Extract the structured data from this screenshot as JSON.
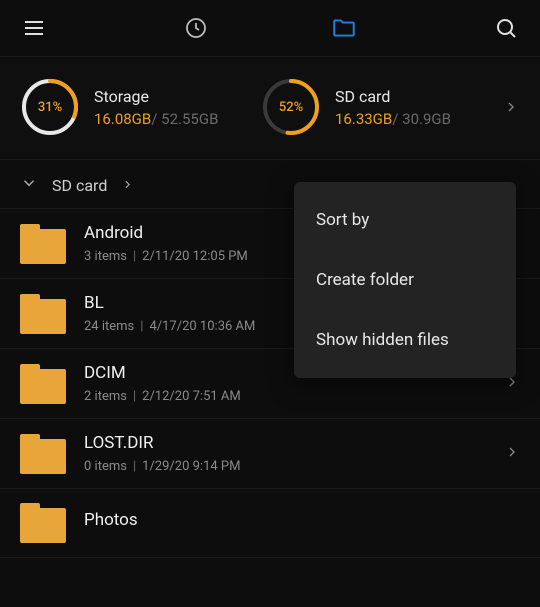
{
  "nav": {
    "menu_icon": "menu",
    "recent_icon": "clock",
    "folder_icon": "folder",
    "search_icon": "search"
  },
  "storage": {
    "internal": {
      "percent_label": "31%",
      "percent_value": 31,
      "title": "Storage",
      "used": "16.08GB",
      "sep": "/ ",
      "total": "52.55GB"
    },
    "sd": {
      "percent_label": "52%",
      "percent_value": 52,
      "title": "SD card",
      "used": "16.33GB",
      "sep": "/ ",
      "total": "30.9GB"
    }
  },
  "breadcrumb": {
    "location": "SD card"
  },
  "folders": [
    {
      "name": "Android",
      "items": "3 items",
      "date": "2/11/20 12:05 PM",
      "has_chevron": false
    },
    {
      "name": "BL",
      "items": "24 items",
      "date": "4/17/20 10:36 AM",
      "has_chevron": false
    },
    {
      "name": "DCIM",
      "items": "2 items",
      "date": "2/12/20 7:51 AM",
      "has_chevron": true
    },
    {
      "name": "LOST.DIR",
      "items": "0 items",
      "date": "1/29/20 9:14 PM",
      "has_chevron": true
    },
    {
      "name": "Photos",
      "items": "",
      "date": "",
      "has_chevron": false
    }
  ],
  "menu": {
    "items": [
      {
        "label": "Sort by"
      },
      {
        "label": "Create folder"
      },
      {
        "label": "Show hidden files"
      }
    ]
  },
  "colors": {
    "accent": "#f0a020",
    "ring_track": "#e8e8e8",
    "bg": "#0d0d0d",
    "folder": "#e8a53a",
    "active_tab": "#1f7fe8"
  }
}
